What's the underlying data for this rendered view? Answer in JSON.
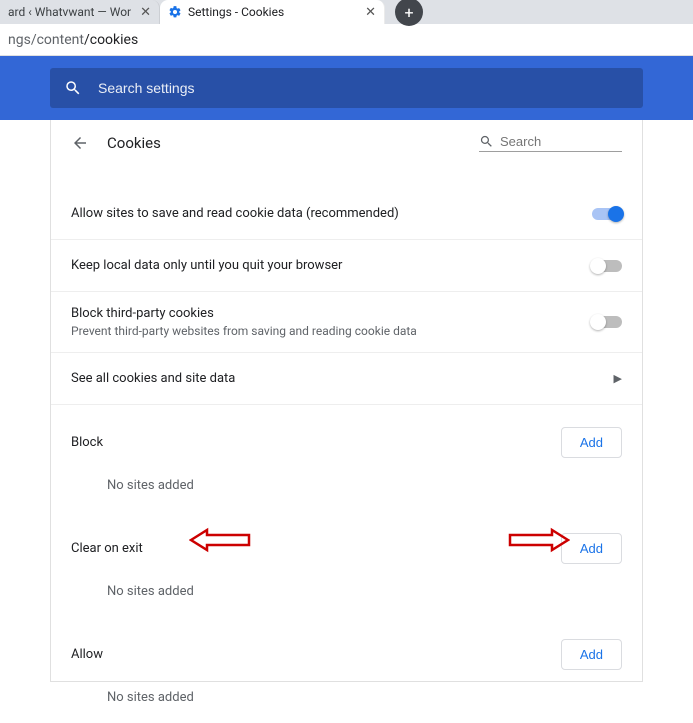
{
  "tabs": {
    "inactive_title": "ard ‹ Whatvwant — Wor",
    "active_title": "Settings - Cookies"
  },
  "address_bar": {
    "prefix": "ngs/content",
    "path": "/cookies"
  },
  "search_settings_placeholder": "Search settings",
  "page_title": "Cookies",
  "local_search_placeholder": "Search",
  "rows": {
    "allow_save": "Allow sites to save and read cookie data (recommended)",
    "keep_local": "Keep local data only until you quit your browser",
    "block_tp_label": "Block third-party cookies",
    "block_tp_desc": "Prevent third-party websites from saving and reading cookie data",
    "see_all": "See all cookies and site data"
  },
  "sections": {
    "block_label": "Block",
    "clear_on_exit_label": "Clear on exit",
    "allow_label": "Allow",
    "add_button": "Add",
    "empty_msg": "No sites added"
  },
  "toggle_states": {
    "allow_save": true,
    "keep_local": false,
    "block_tp": false
  }
}
